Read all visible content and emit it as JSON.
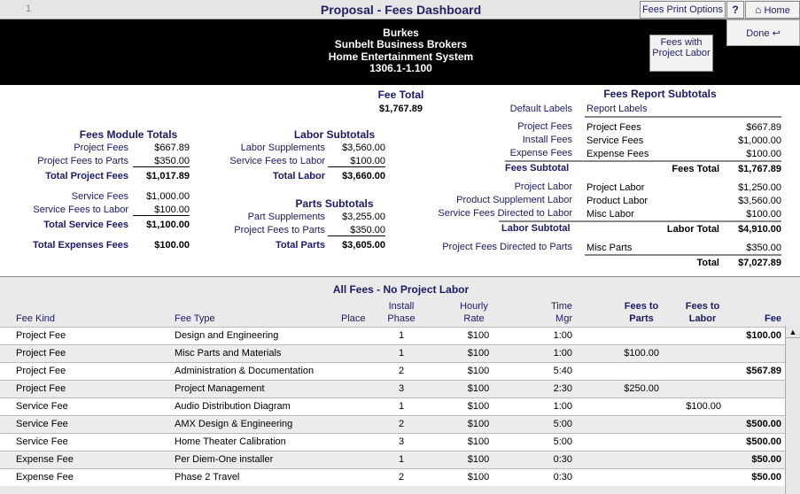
{
  "toolbar": {
    "record_number": "1",
    "title": "Proposal - Fees Dashboard",
    "print_options": "Fees Print Options",
    "help": "?",
    "home": "Home",
    "done": "Done"
  },
  "header": {
    "client": "Burkes",
    "company": "Sunbelt Business Brokers",
    "project": "Home Entertainment System",
    "version": "1306.1-1.100",
    "fees_button": "Fees with Project Labor"
  },
  "fee_total": {
    "label": "Fee Total",
    "value": "$1,767.89"
  },
  "fees_module": {
    "title": "Fees Module Totals",
    "project_fees_label": "Project Fees",
    "project_fees": "$667.89",
    "project_to_parts_label": "Project Fees to Parts",
    "project_to_parts": "$350.00",
    "total_project_label": "Total Project Fees",
    "total_project": "$1,017.89",
    "service_fees_label": "Service Fees",
    "service_fees": "$1,000.00",
    "service_to_labor_label": "Service Fees to Labor",
    "service_to_labor": "$100.00",
    "total_service_label": "Total Service Fees",
    "total_service": "$1,100.00",
    "total_expenses_label": "Total Expenses Fees",
    "total_expenses": "$100.00"
  },
  "labor": {
    "title": "Labor Subtotals",
    "supplements_label": "Labor Supplements",
    "supplements": "$3,560.00",
    "service_to_labor_label": "Service Fees to Labor",
    "service_to_labor": "$100.00",
    "total_label": "Total Labor",
    "total": "$3,660.00"
  },
  "parts": {
    "title": "Parts Subtotals",
    "supplements_label": "Part Supplements",
    "supplements": "$3,255.00",
    "project_to_parts_label": "Project Fees to Parts",
    "project_to_parts": "$350.00",
    "total_label": "Total Parts",
    "total": "$3,605.00"
  },
  "report": {
    "title": "Fees Report Subtotals",
    "default_labels": "Default Labels",
    "report_labels": "Report Labels",
    "rows": [
      {
        "def": "Project Fees",
        "rep": "Project Fees",
        "val": "$667.89"
      },
      {
        "def": "Install Fees",
        "rep": "Service Fees",
        "val": "$1,000.00"
      },
      {
        "def": "Expense Fees",
        "rep": "Expense Fees",
        "val": "$100.00"
      }
    ],
    "fees_subtotal_label": "Fees Subtotal",
    "fees_total_label": "Fees Total",
    "fees_total": "$1,767.89",
    "labor_rows": [
      {
        "def": "Project Labor",
        "rep": "Project Labor",
        "val": "$1,250.00"
      },
      {
        "def": "Product Supplement Labor",
        "rep": "Product Labor",
        "val": "$3,560.00"
      },
      {
        "def": "Service Fees Directed to Labor",
        "rep": "Misc Labor",
        "val": "$100.00"
      }
    ],
    "labor_subtotal_label": "Labor Subtotal",
    "labor_total_label": "Labor Total",
    "labor_total": "$4,910.00",
    "parts_def": "Project Fees Directed to Parts",
    "parts_rep": "Misc Parts",
    "parts_val": "$350.00",
    "total_label": "Total",
    "total": "$7,027.89"
  },
  "table": {
    "title": "All Fees - No Project Labor",
    "headers": {
      "kind": "Fee Kind",
      "type": "Fee Type",
      "place": "Place",
      "phase": "Install Phase",
      "rate": "Hourly Rate",
      "time": "Time Mgr",
      "parts": "Fees to Parts",
      "labor": "Fees to Labor",
      "fee": "Fee"
    },
    "rows": [
      {
        "kind": "Project Fee",
        "type": "Design and Engineering",
        "phase": "1",
        "rate": "$100",
        "time": "1:00",
        "parts": "",
        "labor": "",
        "fee": "$100.00"
      },
      {
        "kind": "Project Fee",
        "type": "Misc Parts and Materials",
        "phase": "1",
        "rate": "$100",
        "time": "1:00",
        "parts": "$100.00",
        "labor": "",
        "fee": ""
      },
      {
        "kind": "Project Fee",
        "type": "Administration & Documentation",
        "phase": "2",
        "rate": "$100",
        "time": "5:40",
        "parts": "",
        "labor": "",
        "fee": "$567.89"
      },
      {
        "kind": "Project Fee",
        "type": "Project Management",
        "phase": "3",
        "rate": "$100",
        "time": "2:30",
        "parts": "$250.00",
        "labor": "",
        "fee": ""
      },
      {
        "kind": "Service Fee",
        "type": "Audio Distribution Diagram",
        "phase": "1",
        "rate": "$100",
        "time": "1:00",
        "parts": "",
        "labor": "$100.00",
        "fee": ""
      },
      {
        "kind": "Service Fee",
        "type": "AMX Design & Engineering",
        "phase": "2",
        "rate": "$100",
        "time": "5:00",
        "parts": "",
        "labor": "",
        "fee": "$500.00"
      },
      {
        "kind": "Service Fee",
        "type": "Home Theater Calibration",
        "phase": "3",
        "rate": "$100",
        "time": "5:00",
        "parts": "",
        "labor": "",
        "fee": "$500.00"
      },
      {
        "kind": "Expense Fee",
        "type": "Per Diem-One installer",
        "phase": "1",
        "rate": "$100",
        "time": "0:30",
        "parts": "",
        "labor": "",
        "fee": "$50.00"
      },
      {
        "kind": "Expense Fee",
        "type": "Phase 2 Travel",
        "phase": "2",
        "rate": "$100",
        "time": "0:30",
        "parts": "",
        "labor": "",
        "fee": "$50.00"
      }
    ]
  }
}
